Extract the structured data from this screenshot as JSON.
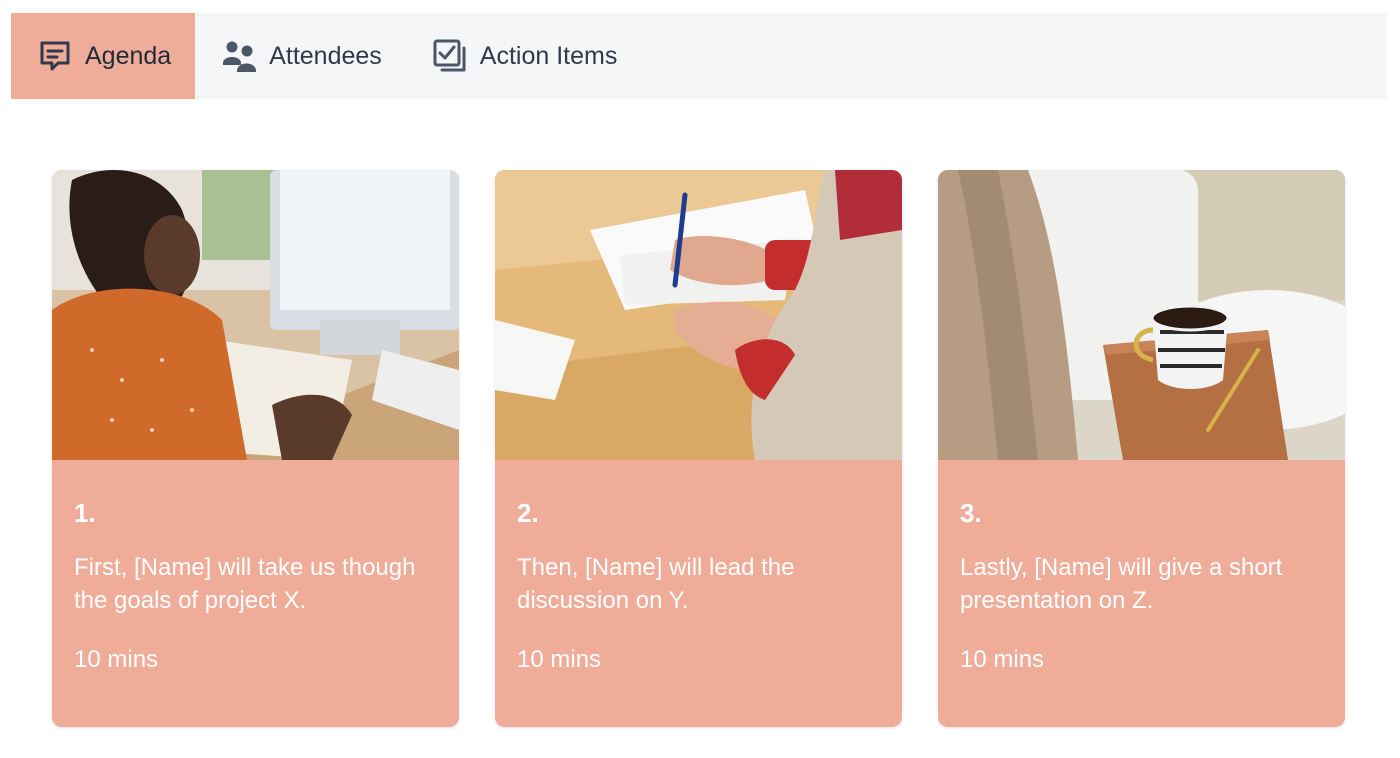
{
  "tabs": [
    {
      "label": "Agenda",
      "icon": "agenda-icon",
      "active": true
    },
    {
      "label": "Attendees",
      "icon": "attendees-icon",
      "active": false
    },
    {
      "label": "Action Items",
      "icon": "checklist-icon",
      "active": false
    }
  ],
  "colors": {
    "accent": "#efac99",
    "tabbar_bg": "#f5f6f8",
    "text_dark": "#2f3a4a",
    "card_text": "#ffffff"
  },
  "agenda": {
    "items": [
      {
        "number": "1.",
        "text": "First, [Name] will take us though the goals of project X.",
        "duration": "10 mins",
        "image": "photo-woman-writing-at-desk"
      },
      {
        "number": "2.",
        "text": "Then, [Name] will lead the discussion on Y.",
        "duration": "10 mins",
        "image": "photo-hands-writing-notes"
      },
      {
        "number": "3.",
        "text": "Lastly, [Name] will give a short presentation on Z.",
        "duration": "10 mins",
        "image": "photo-coffee-cup-on-notebook"
      }
    ]
  }
}
